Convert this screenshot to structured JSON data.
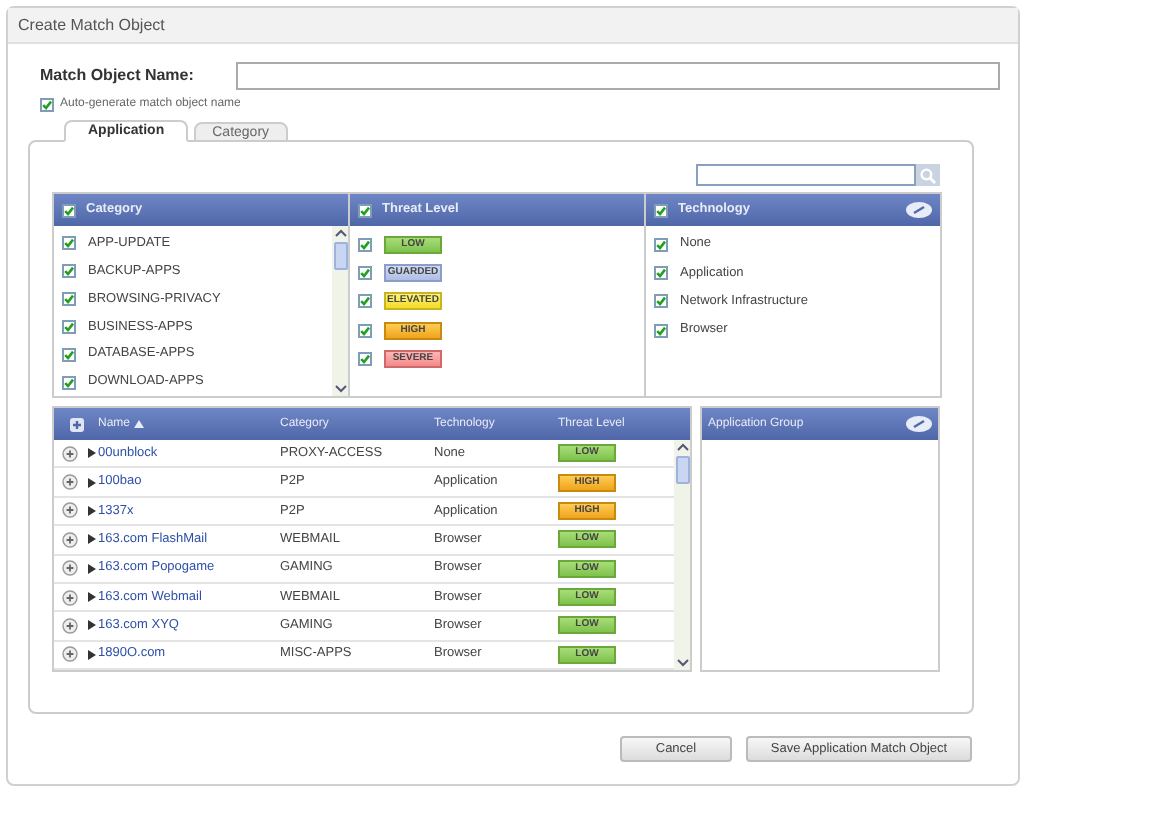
{
  "window": {
    "title": "Create Match Object"
  },
  "name_field": {
    "label": "Match Object Name:"
  },
  "auto_generate": {
    "label": "Auto-generate match object name",
    "checked": true
  },
  "tabs": [
    {
      "label": "Application",
      "selected": true
    },
    {
      "label": "Category",
      "selected": false
    }
  ],
  "category_panel": {
    "title": "Category",
    "checked": true,
    "items": [
      {
        "label": "APP-UPDATE",
        "checked": true
      },
      {
        "label": "BACKUP-APPS",
        "checked": true
      },
      {
        "label": "BROWSING-PRIVACY",
        "checked": true
      },
      {
        "label": "BUSINESS-APPS",
        "checked": true
      },
      {
        "label": "DATABASE-APPS",
        "checked": true
      },
      {
        "label": "DOWNLOAD-APPS",
        "checked": true
      }
    ]
  },
  "threat_panel": {
    "title": "Threat Level",
    "checked": true,
    "items": [
      {
        "label": "LOW",
        "kind": "low",
        "checked": true
      },
      {
        "label": "GUARDED",
        "kind": "guarded",
        "checked": true
      },
      {
        "label": "ELEVATED",
        "kind": "elevated",
        "checked": true
      },
      {
        "label": "HIGH",
        "kind": "high",
        "checked": true
      },
      {
        "label": "SEVERE",
        "kind": "severe",
        "checked": true
      }
    ]
  },
  "technology_panel": {
    "title": "Technology",
    "checked": true,
    "items": [
      {
        "label": "None",
        "checked": true
      },
      {
        "label": "Application",
        "checked": true
      },
      {
        "label": "Network Infrastructure",
        "checked": true
      },
      {
        "label": "Browser",
        "checked": true
      }
    ]
  },
  "table": {
    "columns": [
      "Name",
      "Category",
      "Technology",
      "Threat Level"
    ],
    "rows": [
      {
        "name": "00unblock",
        "category": "PROXY-ACCESS",
        "technology": "None",
        "threat": "LOW",
        "kind": "low"
      },
      {
        "name": "100bao",
        "category": "P2P",
        "technology": "Application",
        "threat": "HIGH",
        "kind": "high"
      },
      {
        "name": "1337x",
        "category": "P2P",
        "technology": "Application",
        "threat": "HIGH",
        "kind": "high"
      },
      {
        "name": "163.com FlashMail",
        "category": "WEBMAIL",
        "technology": "Browser",
        "threat": "LOW",
        "kind": "low"
      },
      {
        "name": "163.com Popogame",
        "category": "GAMING",
        "technology": "Browser",
        "threat": "LOW",
        "kind": "low"
      },
      {
        "name": "163.com Webmail",
        "category": "WEBMAIL",
        "technology": "Browser",
        "threat": "LOW",
        "kind": "low"
      },
      {
        "name": "163.com XYQ",
        "category": "GAMING",
        "technology": "Browser",
        "threat": "LOW",
        "kind": "low"
      },
      {
        "name": "1890O.com",
        "category": "MISC-APPS",
        "technology": "Browser",
        "threat": "LOW",
        "kind": "low"
      }
    ]
  },
  "group_panel": {
    "title": "Application Group"
  },
  "buttons": [
    "Cancel",
    "Save Application Match Object"
  ]
}
